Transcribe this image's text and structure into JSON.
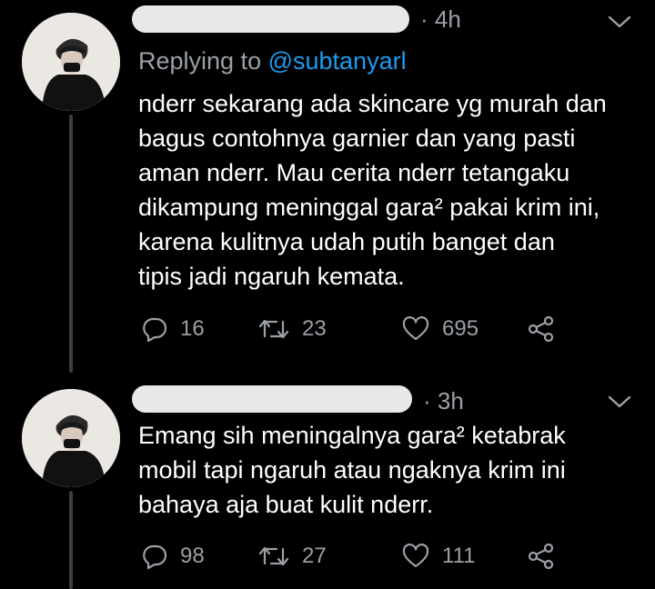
{
  "tweets": [
    {
      "time": "· 4h",
      "replying_prefix": "Replying to ",
      "replying_handle": "@subtanyarl",
      "text": "nderr sekarang ada skincare yg murah dan\nbagus contohnya garnier dan yang pasti\naman nderr. Mau cerita nderr tetangaku\ndikampung meninggal gara² pakai krim ini,\nkarena kulitnya udah putih banget dan\ntipis jadi ngaruh kemata.",
      "replies": "16",
      "retweets": "23",
      "likes": "695"
    },
    {
      "time": "· 3h",
      "text": "Emang sih meningalnya gara² ketabrak\nmobil tapi ngaruh atau ngaknya krim ini\nbahaya aja buat kulit nderr.",
      "replies": "98",
      "retweets": "27",
      "likes": "111"
    }
  ],
  "colors": {
    "background": "#000000",
    "text": "#ffffff",
    "muted": "#9aa0a6",
    "mention": "#1d9bf0",
    "thread_line": "#3a3f43",
    "redaction": "#e6e8ea"
  },
  "icons": [
    "reply-icon",
    "retweet-icon",
    "like-icon",
    "share-icon",
    "chevron-down-icon"
  ]
}
